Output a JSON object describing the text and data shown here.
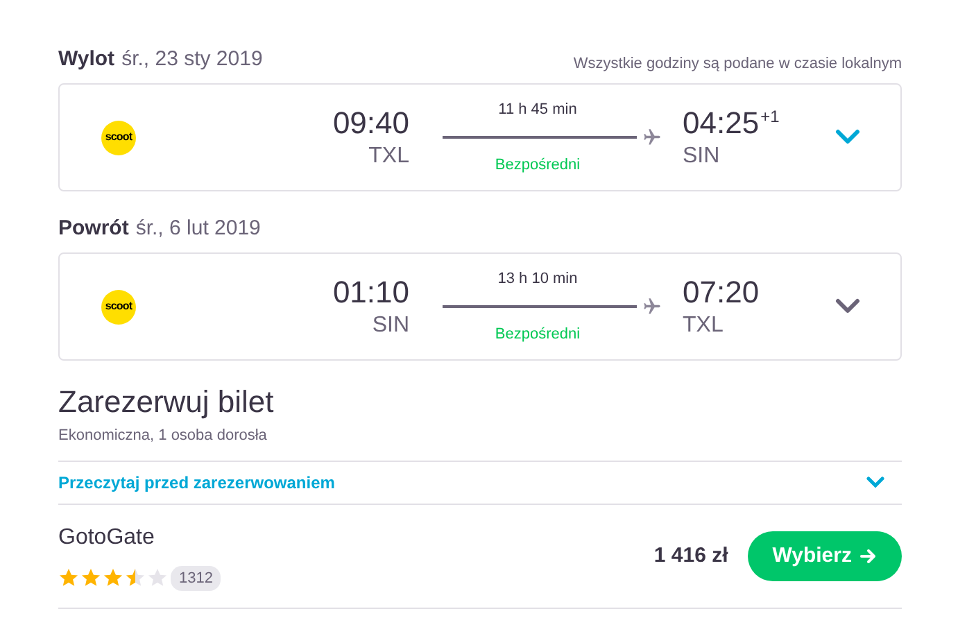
{
  "legs": [
    {
      "label": "Wylot",
      "date": "śr., 23 sty 2019",
      "note": "Wszystkie godziny są podane w czasie lokalnym",
      "airline_logo": "scoot",
      "depart_time": "09:40",
      "depart_airport": "TXL",
      "duration": "11 h 45 min",
      "stops": "Bezpośredni",
      "arrive_time": "04:25",
      "day_offset": "+1",
      "arrive_airport": "SIN",
      "highlighted": true
    },
    {
      "label": "Powrót",
      "date": "śr., 6 lut 2019",
      "airline_logo": "scoot",
      "depart_time": "01:10",
      "depart_airport": "SIN",
      "duration": "13 h 10 min",
      "stops": "Bezpośredni",
      "arrive_time": "07:20",
      "arrive_airport": "TXL",
      "highlighted": false
    }
  ],
  "booking": {
    "title": "Zarezerwuj bilet",
    "subtitle": "Ekonomiczna, 1 osoba dorosła",
    "info_link": "Przeczytaj przed zarezerwowaniem",
    "offers": [
      {
        "provider": "GotoGate",
        "stars": 3.5,
        "reviews": "1312",
        "price": "1 416 zł",
        "button": "Wybierz"
      }
    ]
  }
}
